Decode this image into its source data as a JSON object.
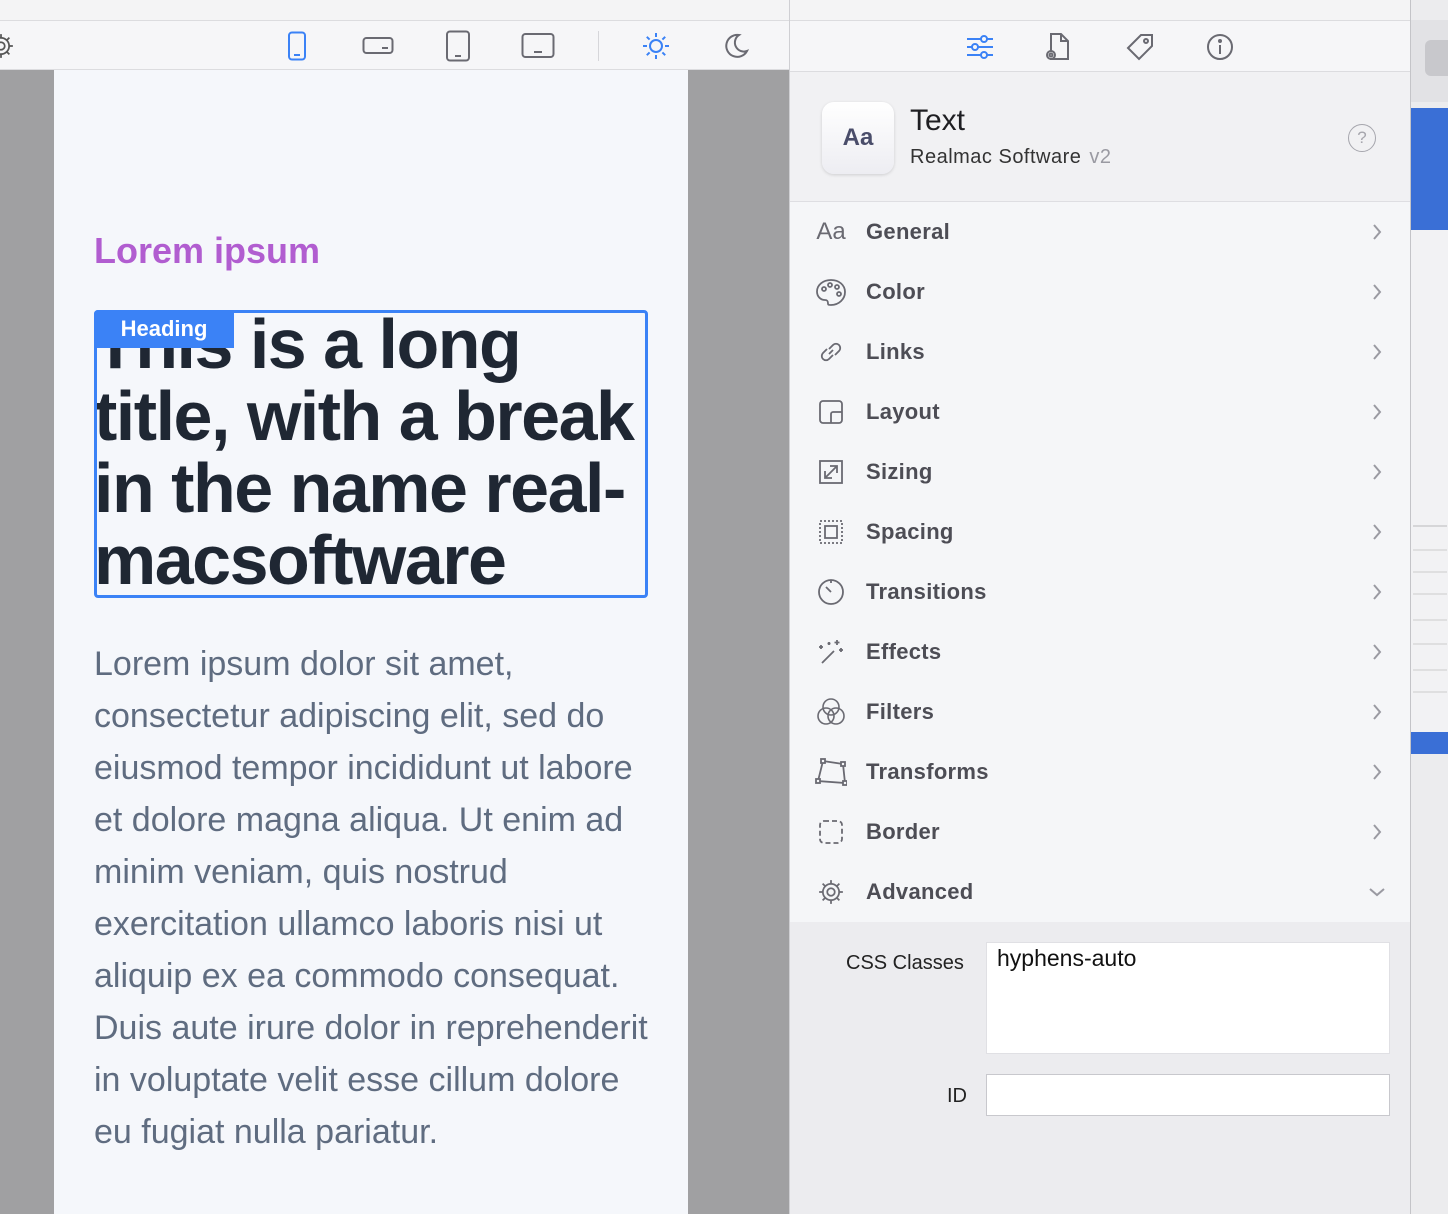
{
  "toolbar": {
    "icons": [
      "gear-icon",
      "phone-portrait-icon",
      "phone-landscape-icon",
      "tablet-portrait-icon",
      "tablet-landscape-icon",
      "light-mode-icon",
      "dark-mode-icon"
    ]
  },
  "canvas": {
    "eyebrow": "Lorem ipsum",
    "selection_tag": "Heading",
    "heading": "This is a long title, with a break in the name real-macsoftware",
    "body": "Lorem ipsum dolor sit amet, consectetur adipiscing elit, sed do eiusmod tempor incididunt ut labore et dolore magna aliqua. Ut enim ad minim veniam, quis nostrud exercitation ullamco laboris nisi ut aliquip ex ea commodo consequat. Duis aute irure dolor in reprehenderit in voluptate velit esse cillum dolore eu fugiat nulla pariatur."
  },
  "inspector": {
    "tabs": [
      "properties-sliders-icon",
      "page-settings-icon",
      "tag-icon",
      "info-icon"
    ],
    "component": {
      "icon_text": "Aa",
      "title": "Text",
      "vendor": "Realmac Software",
      "version": "v2",
      "help": "?"
    },
    "sections": [
      {
        "label": "General",
        "icon": "text-aa-icon"
      },
      {
        "label": "Color",
        "icon": "palette-icon"
      },
      {
        "label": "Links",
        "icon": "link-icon"
      },
      {
        "label": "Layout",
        "icon": "layout-icon"
      },
      {
        "label": "Sizing",
        "icon": "resize-icon"
      },
      {
        "label": "Spacing",
        "icon": "spacing-icon"
      },
      {
        "label": "Transitions",
        "icon": "timer-icon"
      },
      {
        "label": "Effects",
        "icon": "magic-wand-icon"
      },
      {
        "label": "Filters",
        "icon": "filters-circles-icon"
      },
      {
        "label": "Transforms",
        "icon": "transform-icon"
      },
      {
        "label": "Border",
        "icon": "border-dashed-icon"
      },
      {
        "label": "Advanced",
        "icon": "gear-icon"
      }
    ],
    "advanced": {
      "css_classes_label": "CSS Classes",
      "css_classes_value": "hyphens-auto",
      "id_label": "ID",
      "id_value": ""
    }
  },
  "colors": {
    "accent_blue": "#3b82f6",
    "eyebrow_purple": "#b15dd0",
    "heading_text": "#1f2733",
    "body_text": "#5f6c80"
  }
}
